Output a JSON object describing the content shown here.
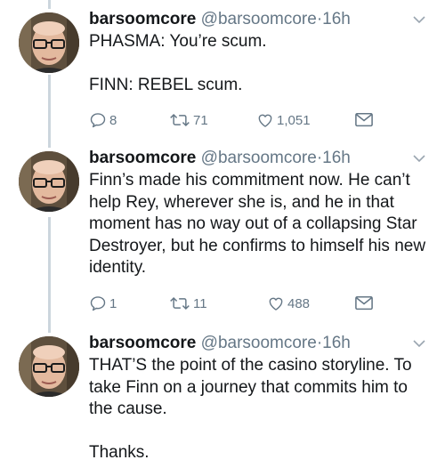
{
  "tweets": [
    {
      "name": "barsoomcore",
      "handle": "@barsoomcore",
      "separator": "·",
      "time": "16h",
      "paragraphs": [
        "PHASMA: You’re scum.",
        "FINN: REBEL scum."
      ],
      "replies": "8",
      "retweets": "71",
      "likes": "1,051"
    },
    {
      "name": "barsoomcore",
      "handle": "@barsoomcore",
      "separator": "·",
      "time": "16h",
      "paragraphs": [
        "Finn’s made his commitment now. He can’t help Rey, wherever she is, and he in that moment has no way out of a collapsing Star Destroyer, but he confirms to himself his new identity."
      ],
      "replies": "1",
      "retweets": "11",
      "likes": "488"
    },
    {
      "name": "barsoomcore",
      "handle": "@barsoomcore",
      "separator": "·",
      "time": "16h",
      "paragraphs": [
        "THAT’S the point of the casino storyline. To take Finn on a journey that commits him to the cause.",
        "Thanks."
      ]
    }
  ],
  "icons": {
    "reply": "reply-icon",
    "retweet": "retweet-icon",
    "like": "heart-icon",
    "message": "envelope-icon",
    "caret": "chevron-down-icon"
  },
  "colors": {
    "text": "#14171a",
    "muted": "#657786",
    "thread_line": "#ccd6dd"
  }
}
